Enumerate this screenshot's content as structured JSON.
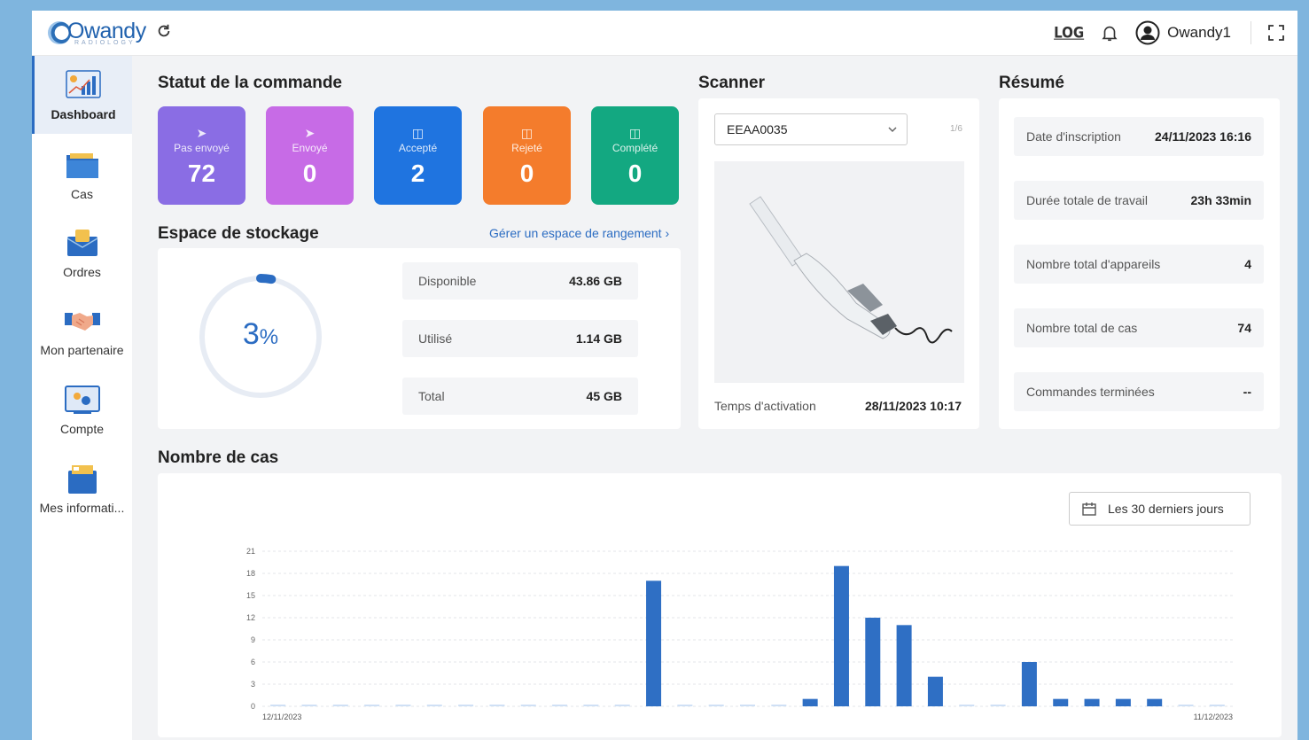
{
  "brand": {
    "name": "Owandy",
    "subtitle": "RADIOLOGY"
  },
  "header": {
    "log_label": "LOG",
    "username": "Owandy1"
  },
  "sidebar": {
    "items": [
      {
        "label": "Dashboard",
        "icon": "dashboard-icon",
        "active": true
      },
      {
        "label": "Cas",
        "icon": "folder-icon"
      },
      {
        "label": "Ordres",
        "icon": "orders-icon"
      },
      {
        "label": "Mon partenaire",
        "icon": "handshake-icon"
      },
      {
        "label": "Compte",
        "icon": "account-icon"
      },
      {
        "label": "Mes informati...",
        "icon": "info-icon"
      }
    ]
  },
  "order_status": {
    "title": "Statut de la commande",
    "tiles": [
      {
        "label": "Pas envoyé",
        "value": "72",
        "color": "#8a6de4"
      },
      {
        "label": "Envoyé",
        "value": "0",
        "color": "#c76be6"
      },
      {
        "label": "Accepté",
        "value": "2",
        "color": "#1f74e0"
      },
      {
        "label": "Rejeté",
        "value": "0",
        "color": "#f47c2c"
      },
      {
        "label": "Complété",
        "value": "0",
        "color": "#13a881"
      }
    ]
  },
  "storage": {
    "title": "Espace de stockage",
    "manage_link": "Gérer un espace de rangement ›",
    "percent_value": "3",
    "percent_sign": "%",
    "percent_fraction": 0.03,
    "rows": [
      {
        "label": "Disponible",
        "value": "43.86 GB"
      },
      {
        "label": "Utilisé",
        "value": "1.14 GB"
      },
      {
        "label": "Total",
        "value": "45 GB"
      }
    ]
  },
  "scanner": {
    "title": "Scanner",
    "selected": "EEAA0035",
    "pager": "1/6",
    "activation_label": "Temps d'activation",
    "activation_value": "28/11/2023 10:17"
  },
  "summary": {
    "title": "Résumé",
    "rows": [
      {
        "label": "Date d'inscription",
        "value": "24/11/2023 16:16"
      },
      {
        "label": "Durée totale de travail",
        "value": "23h 33min"
      },
      {
        "label": "Nombre total d'appareils",
        "value": "4"
      },
      {
        "label": "Nombre total de cas",
        "value": "74"
      },
      {
        "label": "Commandes terminées",
        "value": "--"
      }
    ]
  },
  "cases": {
    "title": "Nombre de cas",
    "range_button": "Les 30 derniers jours"
  },
  "chart_data": {
    "type": "bar",
    "x_start_label": "12/11/2023",
    "x_end_label": "11/12/2023",
    "yticks": [
      "0",
      "3",
      "6",
      "9",
      "12",
      "15",
      "18",
      "21"
    ],
    "ylim": [
      0,
      21
    ],
    "values": [
      0,
      0,
      0,
      0,
      0,
      0,
      0,
      0,
      0,
      0,
      0,
      0,
      17,
      0,
      0,
      0,
      0,
      1,
      19,
      12,
      11,
      4,
      0,
      0,
      6,
      1,
      1,
      1,
      1,
      0,
      0
    ],
    "bar_color": "#2f6fc4",
    "zero_color": "#cfe0f5",
    "grid": true
  }
}
